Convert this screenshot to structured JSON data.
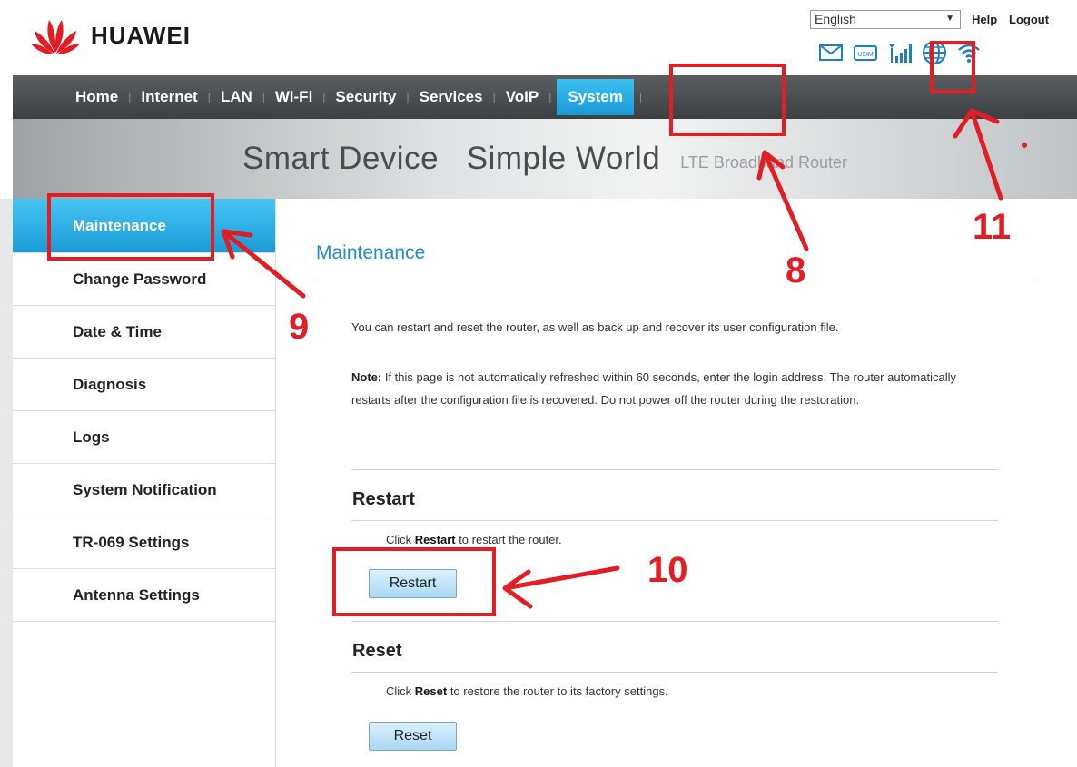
{
  "brand": {
    "name": "HUAWEI",
    "logo_icon": "huawei-petal-logo",
    "color": "#e31d24"
  },
  "header": {
    "language": "English",
    "help_label": "Help",
    "logout_label": "Logout",
    "status_icons": [
      "mail-icon",
      "usim-icon",
      "signal-icon",
      "globe-icon",
      "wifi-icon"
    ]
  },
  "nav": {
    "items": [
      {
        "label": "Home"
      },
      {
        "label": "Internet"
      },
      {
        "label": "LAN"
      },
      {
        "label": "Wi-Fi"
      },
      {
        "label": "Security"
      },
      {
        "label": "Services"
      },
      {
        "label": "VoIP"
      },
      {
        "label": "System",
        "active": true
      }
    ]
  },
  "banner": {
    "main": "Smart Device   Simple World",
    "sub": "LTE Broadband Router"
  },
  "sidebar": {
    "items": [
      {
        "label": "Maintenance",
        "active": true
      },
      {
        "label": "Change Password"
      },
      {
        "label": "Date & Time"
      },
      {
        "label": "Diagnosis"
      },
      {
        "label": "Logs"
      },
      {
        "label": "System Notification"
      },
      {
        "label": "TR-069 Settings"
      },
      {
        "label": "Antenna Settings"
      }
    ]
  },
  "main": {
    "title": "Maintenance",
    "intro": "You can restart and reset the router, as well as back up and recover its user configuration file.",
    "note_label": "Note:",
    "note_text": " If this page is not automatically refreshed within 60 seconds, enter the login address. The router automatically restarts after the configuration file is recovered. Do not power off the router during the restoration.",
    "restart": {
      "title": "Restart",
      "desc_pre": "Click ",
      "desc_bold": "Restart",
      "desc_post": " to restart the router.",
      "button": "Restart"
    },
    "reset": {
      "title": "Reset",
      "desc_pre": "Click ",
      "desc_bold": "Reset",
      "desc_post": " to restore the router to its factory settings.",
      "button": "Reset"
    }
  },
  "annotations": {
    "labels": [
      "8",
      "9",
      "10",
      "11"
    ],
    "color": "#e31d24"
  }
}
